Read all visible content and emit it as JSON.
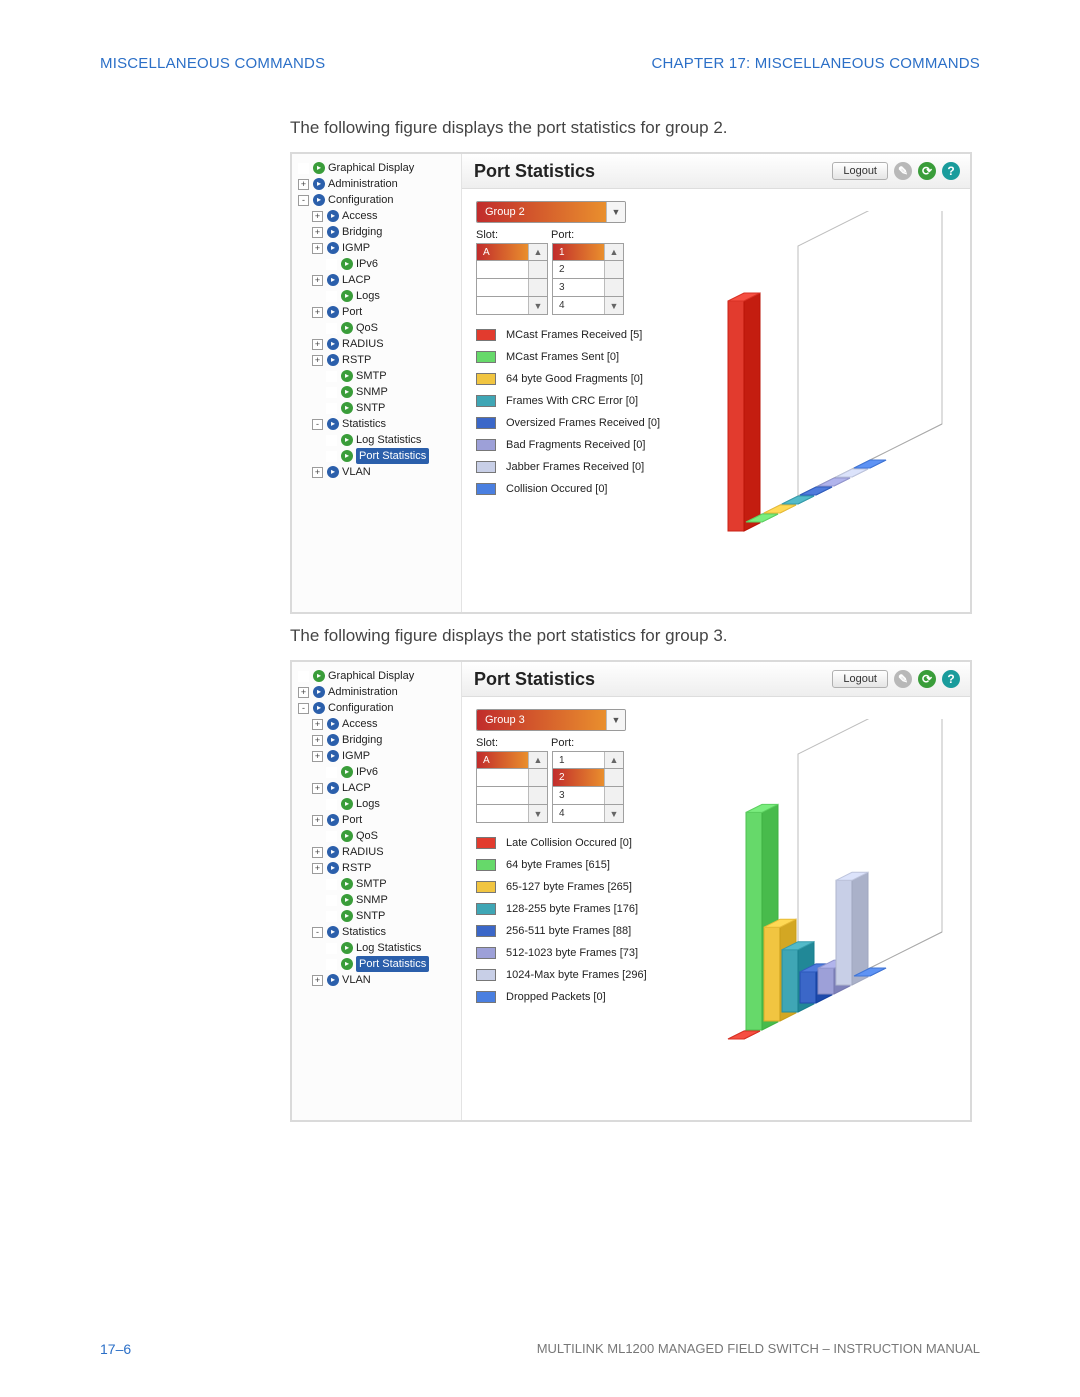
{
  "header": {
    "left": "MISCELLANEOUS COMMANDS",
    "right": "CHAPTER 17: MISCELLANEOUS COMMANDS"
  },
  "captions": {
    "fig2": "The following figure displays the port statistics for group 2.",
    "fig3": "The following figure displays the port statistics for group 3."
  },
  "footer": {
    "page": "17–6",
    "manual": "MULTILINK ML1200 MANAGED FIELD SWITCH – INSTRUCTION MANUAL"
  },
  "ui": {
    "title": "Port Statistics",
    "logout": "Logout",
    "slot_label": "Slot:",
    "port_label": "Port:",
    "slot_value": "A"
  },
  "tree": [
    {
      "d": 1,
      "pm": "",
      "ic": "green",
      "label": "Graphical Display"
    },
    {
      "d": 1,
      "pm": "+",
      "ic": "blue",
      "label": "Administration"
    },
    {
      "d": 1,
      "pm": "-",
      "ic": "blue",
      "label": "Configuration"
    },
    {
      "d": 2,
      "pm": "+",
      "ic": "blue",
      "label": "Access"
    },
    {
      "d": 2,
      "pm": "+",
      "ic": "blue",
      "label": "Bridging"
    },
    {
      "d": 2,
      "pm": "+",
      "ic": "blue",
      "label": "IGMP"
    },
    {
      "d": 3,
      "pm": "",
      "ic": "green",
      "label": "IPv6"
    },
    {
      "d": 2,
      "pm": "+",
      "ic": "blue",
      "label": "LACP"
    },
    {
      "d": 3,
      "pm": "",
      "ic": "green",
      "label": "Logs"
    },
    {
      "d": 2,
      "pm": "+",
      "ic": "blue",
      "label": "Port"
    },
    {
      "d": 3,
      "pm": "",
      "ic": "green",
      "label": "QoS"
    },
    {
      "d": 2,
      "pm": "+",
      "ic": "blue",
      "label": "RADIUS"
    },
    {
      "d": 2,
      "pm": "+",
      "ic": "blue",
      "label": "RSTP"
    },
    {
      "d": 3,
      "pm": "",
      "ic": "green",
      "label": "SMTP"
    },
    {
      "d": 3,
      "pm": "",
      "ic": "green",
      "label": "SNMP"
    },
    {
      "d": 3,
      "pm": "",
      "ic": "green",
      "label": "SNTP"
    },
    {
      "d": 2,
      "pm": "-",
      "ic": "blue",
      "label": "Statistics"
    },
    {
      "d": 3,
      "pm": "",
      "ic": "green",
      "label": "Log Statistics"
    },
    {
      "d": 3,
      "pm": "",
      "ic": "green",
      "label": "Port Statistics",
      "selected": true
    },
    {
      "d": 2,
      "pm": "+",
      "ic": "blue",
      "label": "VLAN"
    }
  ],
  "fig2": {
    "group": "Group 2",
    "port_selected": "1",
    "ports": [
      "1",
      "2",
      "3",
      "4"
    ],
    "legend": [
      {
        "color": "#e23b2e",
        "label": "MCast Frames Received [5]"
      },
      {
        "color": "#66d96a",
        "label": "MCast Frames Sent [0]"
      },
      {
        "color": "#f1c541",
        "label": "64 byte Good Fragments [0]"
      },
      {
        "color": "#3fa6b5",
        "label": "Frames With CRC Error [0]"
      },
      {
        "color": "#3b67c8",
        "label": "Oversized Frames Received [0]"
      },
      {
        "color": "#9da0d8",
        "label": "Bad Fragments Received [0]"
      },
      {
        "color": "#c8cfe7",
        "label": "Jabber Frames Received [0]"
      },
      {
        "color": "#4a7fe0",
        "label": "Collision Occured [0]"
      }
    ]
  },
  "fig3": {
    "group": "Group 3",
    "port_selected": "2",
    "ports": [
      "1",
      "2",
      "3",
      "4"
    ],
    "legend": [
      {
        "color": "#e23b2e",
        "label": "Late Collision Occured [0]"
      },
      {
        "color": "#66d96a",
        "label": "64 byte Frames [615]"
      },
      {
        "color": "#f1c541",
        "label": "65-127 byte Frames [265]"
      },
      {
        "color": "#3fa6b5",
        "label": "128-255 byte Frames [176]"
      },
      {
        "color": "#3b67c8",
        "label": "256-511 byte Frames [88]"
      },
      {
        "color": "#9da0d8",
        "label": "512-1023 byte Frames [73]"
      },
      {
        "color": "#c8cfe7",
        "label": "1024-Max byte Frames [296]"
      },
      {
        "color": "#4a7fe0",
        "label": "Dropped Packets [0]"
      }
    ]
  },
  "chart_data": [
    {
      "type": "bar",
      "orientation": "3d-isometric",
      "title": "Port Statistics – Group 2",
      "categories": [
        "MCast Frames Received",
        "MCast Frames Sent",
        "64 byte Good Fragments",
        "Frames With CRC Error",
        "Oversized Frames Received",
        "Bad Fragments Received",
        "Jabber Frames Received",
        "Collision Occured"
      ],
      "values": [
        5,
        0,
        0,
        0,
        0,
        0,
        0,
        0
      ],
      "colors": [
        "#e23b2e",
        "#66d96a",
        "#f1c541",
        "#3fa6b5",
        "#3b67c8",
        "#9da0d8",
        "#c8cfe7",
        "#4a7fe0"
      ],
      "ylim": [
        0,
        5
      ]
    },
    {
      "type": "bar",
      "orientation": "3d-isometric",
      "title": "Port Statistics – Group 3",
      "categories": [
        "Late Collision Occured",
        "64 byte Frames",
        "65-127 byte Frames",
        "128-255 byte Frames",
        "256-511 byte Frames",
        "512-1023 byte Frames",
        "1024-Max byte Frames",
        "Dropped Packets"
      ],
      "values": [
        0,
        615,
        265,
        176,
        88,
        73,
        296,
        0
      ],
      "colors": [
        "#e23b2e",
        "#66d96a",
        "#f1c541",
        "#3fa6b5",
        "#3b67c8",
        "#9da0d8",
        "#c8cfe7",
        "#4a7fe0"
      ],
      "ylim": [
        0,
        650
      ]
    }
  ]
}
